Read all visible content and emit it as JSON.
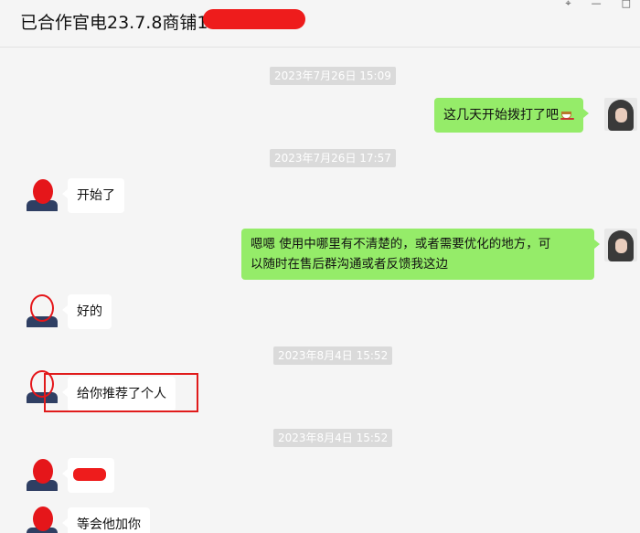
{
  "header": {
    "title": "已合作官电23.7.8商铺1"
  },
  "window_controls": {
    "pin": "⌖",
    "minimize": "—",
    "maximize": "□"
  },
  "messages": [
    {
      "timestamp": "2023年7月26日 15:09"
    },
    {
      "text": "这几天开始拨打了吧",
      "emoji": "coffee-icon"
    },
    {
      "timestamp": "2023年7月26日 17:57"
    },
    {
      "text": "开始了"
    },
    {
      "text_line1": "嗯嗯  使用中哪里有不清楚的，或者需要优化的地方，可",
      "text_line2": "以随时在售后群沟通或者反馈我这边"
    },
    {
      "text": "好的"
    },
    {
      "timestamp": "2023年8月4日 15:52"
    },
    {
      "text": "给你推荐了个人"
    },
    {
      "timestamp": "2023年8月4日 15:52"
    },
    {
      "text": "等会他加你"
    }
  ],
  "colors": {
    "background": "#f5f5f5",
    "self_bubble": "#95ec69",
    "other_bubble": "#ffffff",
    "timestamp_bg": "#dadada",
    "redaction": "#ee1c1c"
  }
}
